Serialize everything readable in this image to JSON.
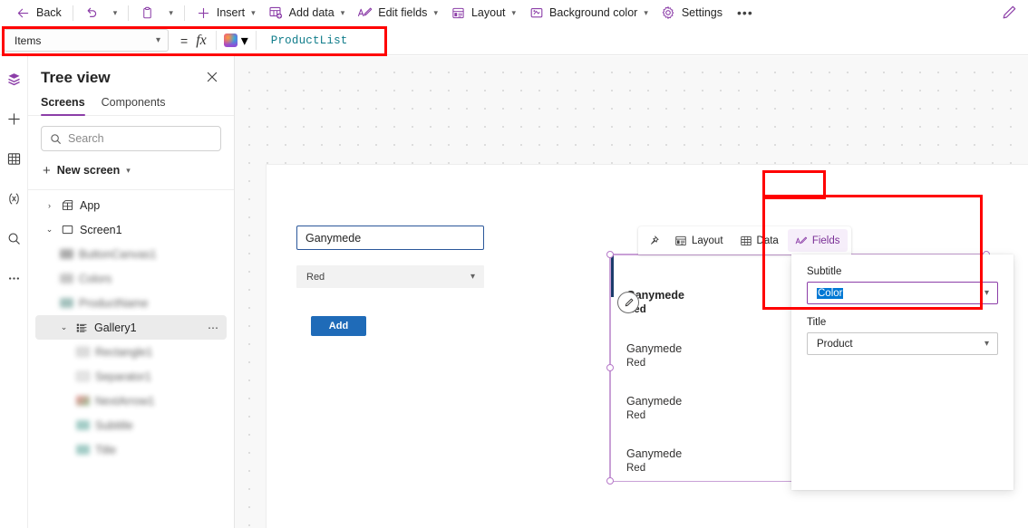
{
  "commandbar": {
    "back_label": "Back",
    "undo_icon": "undo-icon",
    "paste_icon": "clipboard-icon",
    "insert_label": "Insert",
    "add_data_label": "Add data",
    "edit_fields_label": "Edit fields",
    "layout_label": "Layout",
    "background_color_label": "Background color",
    "settings_label": "Settings",
    "overflow_label": "•••",
    "edit_pen_icon": "pencil-icon"
  },
  "formulabar": {
    "property": "Items",
    "equals": "=",
    "fx": "fx",
    "copilot_icon": "copilot-icon",
    "formula": "ProductList",
    "formula_color": "#0f7c8a",
    "highlight_color": "#ff0000"
  },
  "rail": {
    "items": [
      {
        "name": "tree-view-icon",
        "label": "Tree view",
        "active": true
      },
      {
        "name": "insert-icon",
        "label": "Insert",
        "active": false
      },
      {
        "name": "data-icon",
        "label": "Data",
        "active": false
      },
      {
        "name": "variables-icon",
        "label": "Variables",
        "active": false
      },
      {
        "name": "search-icon",
        "label": "Search",
        "active": false
      },
      {
        "name": "more-icon",
        "label": "More",
        "active": false
      }
    ]
  },
  "treeview": {
    "title": "Tree view",
    "close_label": "×",
    "tabs": [
      {
        "label": "Screens",
        "selected": true
      },
      {
        "label": "Components",
        "selected": false
      }
    ],
    "search_placeholder": "Search",
    "new_screen_label": "New screen",
    "nodes": [
      {
        "label": "App",
        "icon": "app-icon",
        "expander": "›",
        "indent": 0,
        "blurred": false,
        "selected": false
      },
      {
        "label": "Screen1",
        "icon": "screen-icon",
        "expander": "⌄",
        "indent": 0,
        "blurred": false,
        "selected": false
      },
      {
        "label": "ButtonCanvas1",
        "icon": "button-icon",
        "expander": "",
        "indent": 1,
        "blurred": true,
        "selected": false
      },
      {
        "label": "Colors",
        "icon": "dropdown-icon",
        "expander": "",
        "indent": 1,
        "blurred": true,
        "selected": false
      },
      {
        "label": "ProductName",
        "icon": "textinput-icon",
        "expander": "",
        "indent": 1,
        "blurred": true,
        "selected": false
      },
      {
        "label": "Gallery1",
        "icon": "gallery-icon",
        "expander": "⌄",
        "indent": 1,
        "blurred": false,
        "selected": true,
        "overflow": "⋯"
      },
      {
        "label": "Rectangle1",
        "icon": "rectangle-icon",
        "expander": "",
        "indent": 2,
        "blurred": true,
        "selected": false
      },
      {
        "label": "Separator1",
        "icon": "separator-icon",
        "expander": "",
        "indent": 2,
        "blurred": true,
        "selected": false
      },
      {
        "label": "NextArrow1",
        "icon": "arrow-icon",
        "expander": "",
        "indent": 2,
        "blurred": true,
        "selected": false
      },
      {
        "label": "Subtitle",
        "icon": "label-icon",
        "expander": "",
        "indent": 2,
        "blurred": true,
        "selected": false
      },
      {
        "label": "Title",
        "icon": "label-icon",
        "expander": "",
        "indent": 2,
        "blurred": true,
        "selected": false
      }
    ]
  },
  "canvas": {
    "product_name_value": "Ganymede",
    "color_dropdown_value": "Red",
    "add_button_label": "Add",
    "gallery_tabs": [
      {
        "label": "",
        "icon": "pin-icon",
        "selected": false
      },
      {
        "label": "Layout",
        "icon": "layout-icon",
        "selected": false
      },
      {
        "label": "Data",
        "icon": "data-icon",
        "selected": false
      },
      {
        "label": "Fields",
        "icon": "fields-icon",
        "selected": true
      }
    ],
    "gallery_rows": [
      {
        "title": "Ganymede",
        "subtitle": "Red"
      },
      {
        "title": "Ganymede",
        "subtitle": "Red"
      },
      {
        "title": "Ganymede",
        "subtitle": "Red"
      },
      {
        "title": "Ganymede",
        "subtitle": "Red"
      }
    ]
  },
  "fields_panel": {
    "subtitle_label": "Subtitle",
    "subtitle_value": "Color",
    "title_label": "Title",
    "title_value": "Product"
  }
}
